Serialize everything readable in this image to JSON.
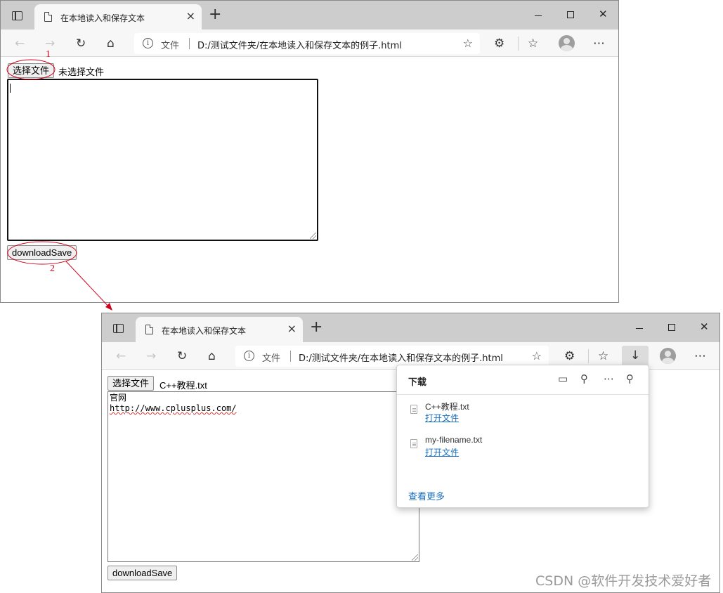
{
  "browser": {
    "tab_title": "在本地读入和保存文本",
    "tab_close": "×",
    "new_tab": "+",
    "win_close": "✕",
    "site_info_label": "文件",
    "url": "D:/测试文件夹/在本地读入和保存文本的例子.html"
  },
  "page1": {
    "choose_file_label": "选择文件",
    "file_status": "未选择文件",
    "textarea_value": "",
    "save_button": "downloadSave"
  },
  "page2": {
    "choose_file_label": "选择文件",
    "file_status": "C++教程.txt",
    "textarea_line1": "官网",
    "textarea_line2": "http://www.cplusplus.com/",
    "save_button": "downloadSave"
  },
  "downloads": {
    "title": "下载",
    "items": [
      {
        "name": "C++教程.txt",
        "action": "打开文件"
      },
      {
        "name": "my-filename.txt",
        "action": "打开文件"
      }
    ],
    "see_more": "查看更多"
  },
  "annotations": {
    "step1": "1",
    "step2": "2",
    "color": "#d0021b"
  },
  "icons": [
    "tab-actions-icon",
    "document-icon",
    "back-icon",
    "forward-icon",
    "refresh-icon",
    "home-icon",
    "info-icon",
    "add-favorite-icon",
    "extensions-icon",
    "favorites-icon",
    "profile-icon",
    "more-icon",
    "download-icon",
    "folder-icon",
    "search-icon",
    "pin-icon",
    "file-icon"
  ],
  "watermark": "CSDN @软件开发技术爱好者"
}
